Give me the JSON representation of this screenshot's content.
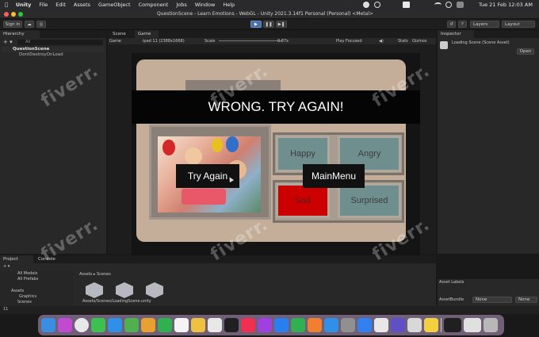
{
  "menubar": {
    "app_name": "Unity",
    "items": [
      "File",
      "Edit",
      "Assets",
      "GameObject",
      "Component",
      "Jobs",
      "Window",
      "Help"
    ],
    "clock": "Tue 21 Feb  12:03 AM"
  },
  "window": {
    "title": "QuestionScene - Learn Emotions - WebGL - Unity 2021.3.14f1 Personal (Personal) <Metal>"
  },
  "toolbar": {
    "sign_in": "Sign in",
    "layers": "Layers",
    "layout": "Layout"
  },
  "hierarchy": {
    "tab": "Hierarchy",
    "search_placeholder": "All",
    "items": [
      {
        "label": "QuestionScene"
      },
      {
        "label": "DontDestroyOnLoad"
      }
    ]
  },
  "scene_tabs": {
    "scene": "Scene",
    "game": "Game"
  },
  "game_toolbar": {
    "display": "Game",
    "resolution": "ipad 11 (2388x1668)",
    "scale_label": "Scale",
    "scale_value": "0.87x",
    "play_focused": "Play Focused",
    "stats": "Stats",
    "gizmos": "Gizmos"
  },
  "game": {
    "banner": "WRONG. TRY AGAIN!",
    "try_again": "Try Again",
    "main_menu": "MainMenu",
    "choices": [
      "Happy",
      "Angry",
      "Sad",
      "Surprised"
    ],
    "colors": {
      "sad": "#cc0000",
      "choice": "#6f8f8e",
      "panel": "#c4ae9a"
    }
  },
  "inspector": {
    "tab": "Inspector",
    "object_name": "Loading Scene (Scene Asset)",
    "open_label": "Open"
  },
  "project": {
    "tabs": [
      "Project",
      "Console"
    ],
    "favorites": [
      "All Models",
      "All Prefabs"
    ],
    "tree": [
      "Assets",
      "Graphics",
      "Scenes"
    ],
    "breadcrumb": [
      "Assets",
      "Scenes"
    ],
    "selected_path": "Assets/Scenes/LoadingScene.unity",
    "asset_labels": "Asset Labels",
    "asset_bundle": "AssetBundle",
    "bundle_none": "None",
    "bundle_none2": "None",
    "count_label": "11"
  },
  "watermark": "fiverr."
}
